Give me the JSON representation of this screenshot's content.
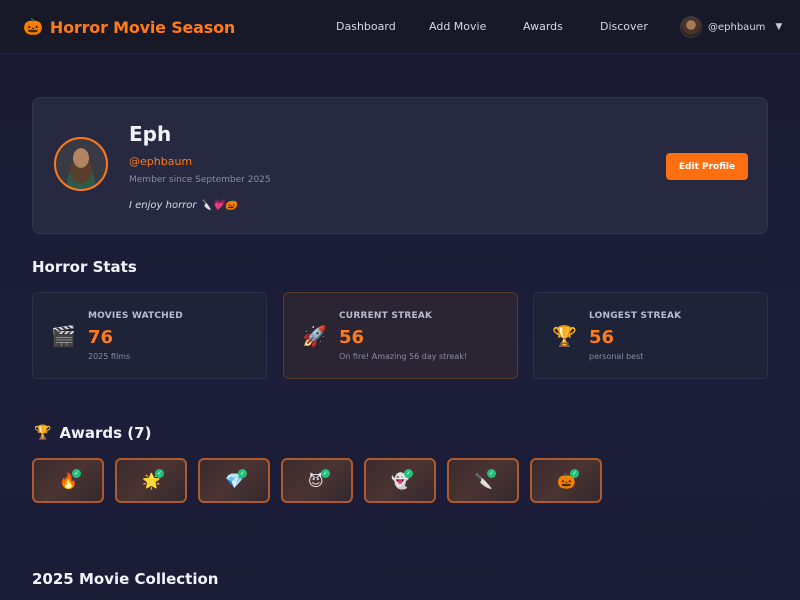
{
  "nav": {
    "brand_icon": "🎃",
    "brand_title": "Horror Movie Season",
    "links": [
      "Dashboard",
      "Add Movie",
      "Awards",
      "Discover"
    ],
    "user": "@ephbaum",
    "caret": "▼"
  },
  "profile": {
    "name": "Eph",
    "handle": "@ephbaum",
    "member_since": "Member since September 2025",
    "bio": "I enjoy horror 🔪💗🎃",
    "edit_label": "Edit Profile"
  },
  "stats": {
    "title": "Horror Stats",
    "cards": [
      {
        "icon": "🎬",
        "label": "MOVIES WATCHED",
        "value": "76",
        "sub": "2025 films"
      },
      {
        "icon": "🚀",
        "label": "CURRENT STREAK",
        "value": "56",
        "sub": "On fire! Amazing 56 day streak!"
      },
      {
        "icon": "🏆",
        "label": "LONGEST STREAK",
        "value": "56",
        "sub": "personal best"
      }
    ]
  },
  "awards": {
    "icon": "🏆",
    "title": "Awards (7)",
    "items": [
      {
        "emoji": "🔥",
        "icon": "fire-icon"
      },
      {
        "emoji": "🌟",
        "icon": "sun-icon"
      },
      {
        "emoji": "💎",
        "icon": "diamond-icon"
      },
      {
        "emoji": "😈",
        "icon": "devil-icon"
      },
      {
        "emoji": "👻",
        "icon": "ghost-icon"
      },
      {
        "emoji": "🔪",
        "icon": "knife-icon"
      },
      {
        "emoji": "🎃",
        "icon": "pumpkin-icon"
      }
    ],
    "check": "✓"
  },
  "collection": {
    "title": "2025 Movie Collection"
  },
  "colors": {
    "accent": "#ff7a1a",
    "background": "#1a1b35",
    "card": "#272940",
    "check": "#22c07a"
  }
}
